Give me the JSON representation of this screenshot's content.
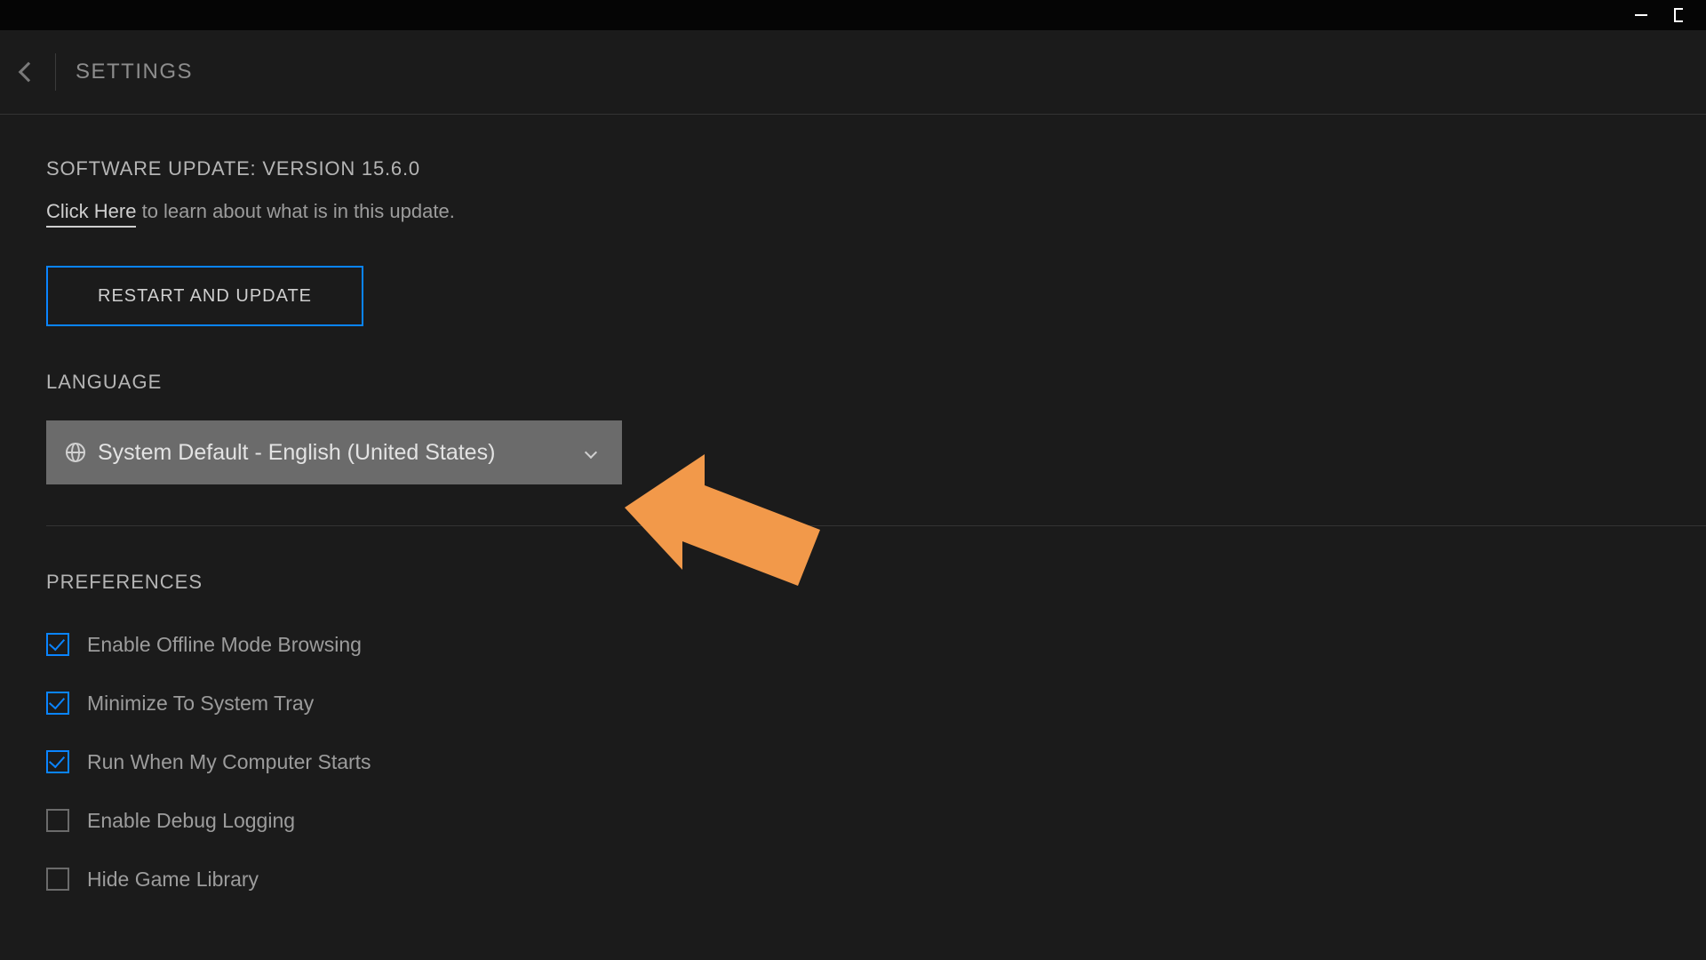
{
  "header": {
    "title": "SETTINGS"
  },
  "software_update": {
    "heading": "SOFTWARE UPDATE: VERSION 15.6.0",
    "link_text": "Click Here",
    "tail_text": " to learn about what is in this update.",
    "restart_button": "RESTART AND UPDATE"
  },
  "language": {
    "section": "LANGUAGE",
    "selected": "System Default - English (United States)"
  },
  "preferences": {
    "section": "PREFERENCES",
    "items": [
      {
        "label": "Enable Offline Mode Browsing",
        "checked": true
      },
      {
        "label": "Minimize To System Tray",
        "checked": true
      },
      {
        "label": "Run When My Computer Starts",
        "checked": true
      },
      {
        "label": "Enable Debug Logging",
        "checked": false
      },
      {
        "label": "Hide Game Library",
        "checked": false
      }
    ]
  },
  "overlay": {
    "arrow_color": "#f2994a"
  }
}
